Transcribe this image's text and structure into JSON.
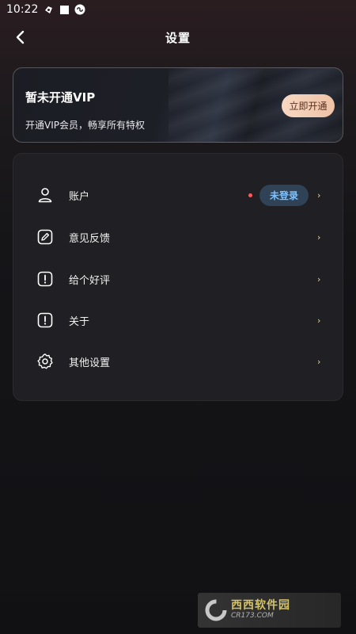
{
  "status_bar": {
    "time": "10:22"
  },
  "header": {
    "title": "设置"
  },
  "vip": {
    "title": "暂未开通VIP",
    "subtitle": "开通VIP会员，畅享所有特权",
    "button": "立即开通"
  },
  "menu": {
    "items": [
      {
        "label": "账户",
        "icon": "user-icon"
      },
      {
        "label": "意见反馈",
        "icon": "edit-icon"
      },
      {
        "label": "给个好评",
        "icon": "alert-icon"
      },
      {
        "label": "关于",
        "icon": "info-icon"
      },
      {
        "label": "其他设置",
        "icon": "gear-icon"
      }
    ],
    "account_badge": "未登录",
    "chevron": "›"
  },
  "watermark": {
    "brand": "西西软件园",
    "site": "CR173.COM"
  }
}
